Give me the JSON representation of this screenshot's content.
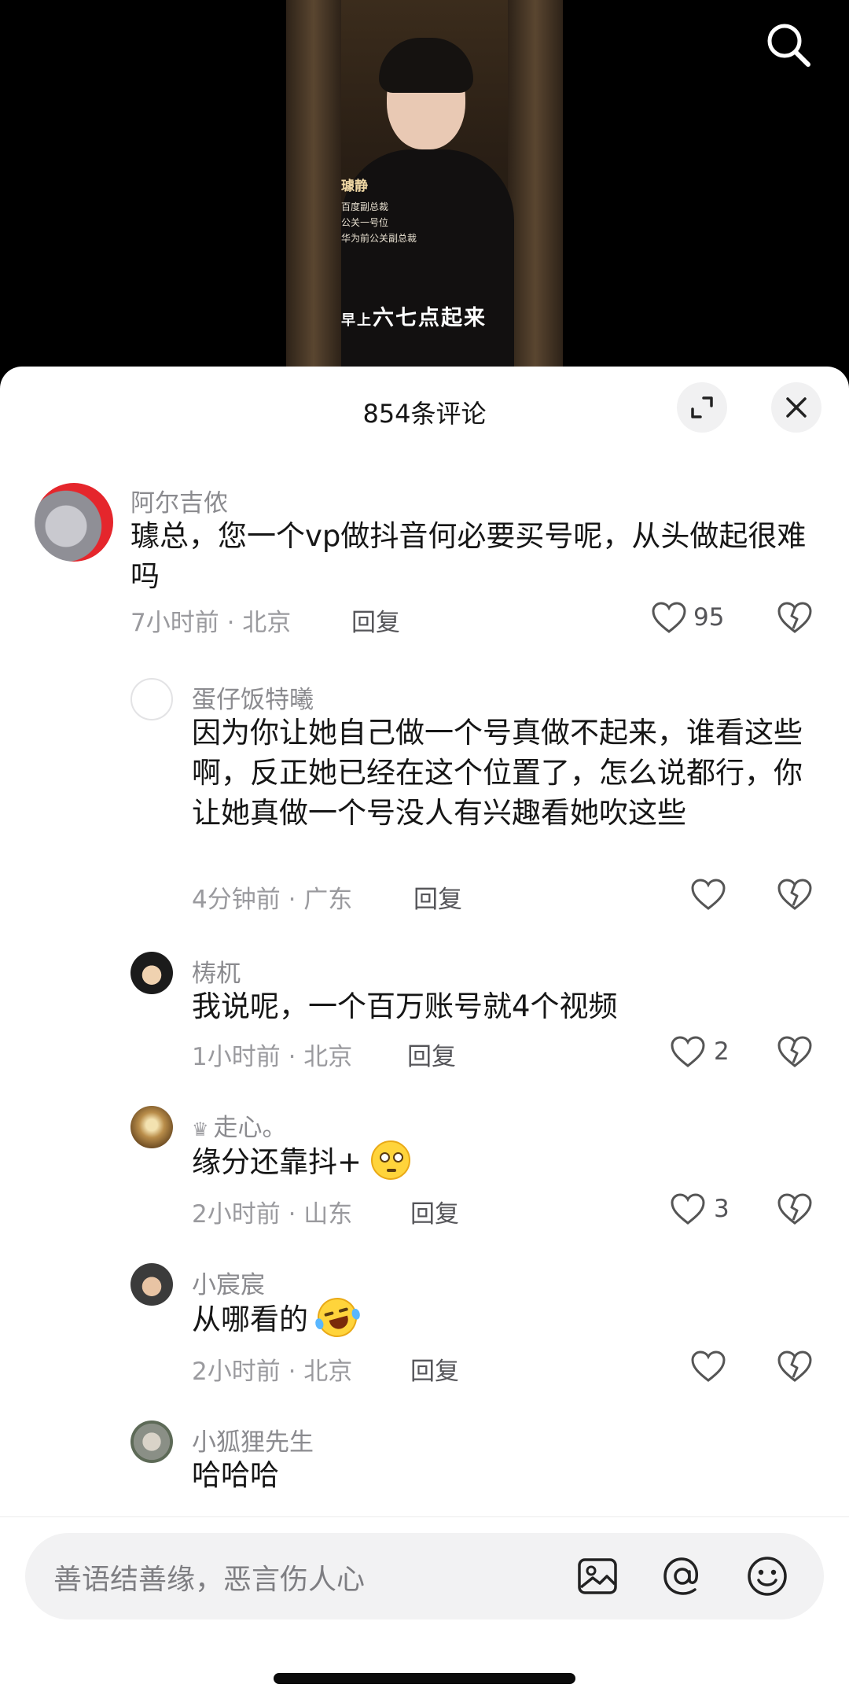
{
  "video": {
    "person_name": "璩静",
    "title_lines": [
      "百度副总裁",
      "公关一号位",
      "华为前公关副总裁"
    ],
    "subtitle_small": "早上",
    "subtitle_big": "六七点起来"
  },
  "search": {
    "icon": "search-icon"
  },
  "sheet": {
    "title": "854条评论"
  },
  "comments": [
    {
      "user": "阿尔吉侬",
      "text": "璩总，您一个vp做抖音何必要买号呢，从头做起很难吗",
      "time": "7小时前 · 北京",
      "reply": "回复",
      "likes": "95"
    },
    {
      "user": "蛋仔饭特曦",
      "text": "因为你让她自己做一个号真做不起来，谁看这些啊，反正她已经在这个位置了，怎么说都行，你让她真做一个号没人有兴趣看她吹这些",
      "time": "4分钟前 · 广东",
      "reply": "回复",
      "likes": ""
    },
    {
      "user": "梼杌",
      "text": "我说呢，一个百万账号就4个视频",
      "time": "1小时前 · 北京",
      "reply": "回复",
      "likes": "2"
    },
    {
      "user": "走心。",
      "text": "缘分还靠抖+",
      "time": "2小时前 · 山东",
      "reply": "回复",
      "likes": "3"
    },
    {
      "user": "小宸宸",
      "text": "从哪看的",
      "time": "2小时前 · 北京",
      "reply": "回复",
      "likes": ""
    },
    {
      "user": "小狐狸先生",
      "text": "哈哈哈",
      "time": "",
      "reply": "",
      "likes": ""
    }
  ],
  "input": {
    "placeholder": "善语结善缘，恶言伤人心"
  },
  "colors": {
    "accent_red": "#e5262c",
    "text": "#161616",
    "muted": "#8b8b8f"
  }
}
